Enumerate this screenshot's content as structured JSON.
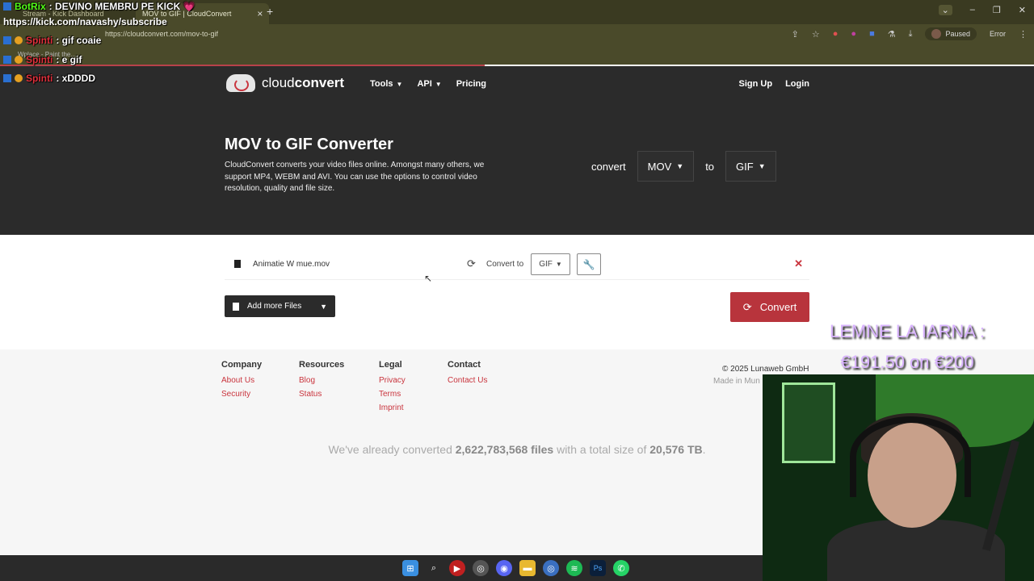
{
  "browser": {
    "tabs": [
      {
        "label": "Stream - Kick Dashboard"
      },
      {
        "label": "MOV to GIF | CloudConvert"
      }
    ],
    "url": "https://cloudconvert.com/mov-to-gif",
    "paused_label": "Paused",
    "error_label": "Error",
    "bookmark": "Wplace - Paint the..."
  },
  "site": {
    "logo_text_light": "cloud",
    "logo_text_bold": "convert",
    "nav": [
      {
        "label": "Tools",
        "caret": true
      },
      {
        "label": "API",
        "caret": true
      },
      {
        "label": "Pricing",
        "caret": false
      }
    ],
    "signup": "Sign Up",
    "login": "Login"
  },
  "hero": {
    "title": "MOV to GIF Converter",
    "description": "CloudConvert converts your video files online. Amongst many others, we support MP4, WEBM and AVI. You can use the options to control video resolution, quality and file size.",
    "convert_word": "convert",
    "from_format": "MOV",
    "to_word": "to",
    "to_format": "GIF"
  },
  "file": {
    "name": "Animatie W mue.mov",
    "convert_to_label": "Convert to",
    "target_format": "GIF"
  },
  "actions": {
    "add_more": "Add more Files",
    "convert": "Convert"
  },
  "footer": {
    "columns": [
      {
        "heading": "Company",
        "links": [
          "About Us",
          "Security"
        ]
      },
      {
        "heading": "Resources",
        "links": [
          "Blog",
          "Status"
        ]
      },
      {
        "heading": "Legal",
        "links": [
          "Privacy",
          "Terms",
          "Imprint"
        ]
      },
      {
        "heading": "Contact",
        "links": [
          "Contact Us"
        ]
      }
    ],
    "copyright": "© 2025 Lunaweb GmbH",
    "made_in": "Made in Mun",
    "stats_prefix": "We've already converted",
    "stats_files": "2,622,783,568 files",
    "stats_mid": "with a total size of",
    "stats_size": "20,576 TB",
    "stats_suffix": "."
  },
  "overlay": {
    "chat": [
      {
        "user": "BotRix",
        "message": ": DEVINO MEMBRU PE KICK 💗"
      },
      {
        "user": "Spinti",
        "message": ": gif coaie"
      },
      {
        "user": "Spinti",
        "message": ": e gif"
      },
      {
        "user": "Spinti",
        "message": ": xDDDD"
      }
    ],
    "sub_link": "https://kick.com/navashy/subscribe",
    "goal_line1": "LEMNE LA IARNA :",
    "goal_line2": "€191.50 on €200"
  },
  "colors": {
    "accent": "#b8343c",
    "hero_bg": "#2b2b2b"
  }
}
